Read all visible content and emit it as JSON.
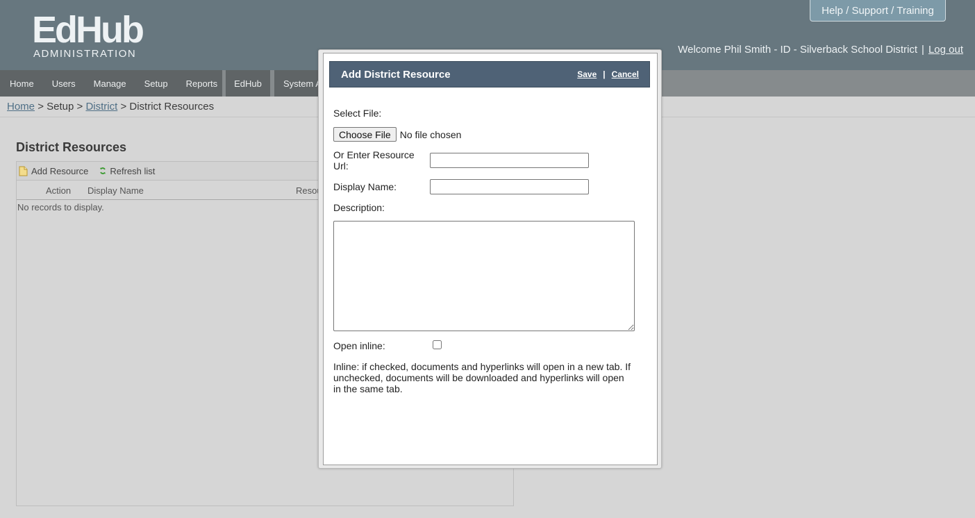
{
  "app": {
    "logo_main": "EdHub",
    "logo_sub": "ADMINISTRATION",
    "help_button": "Help / Support / Training",
    "welcome_text": "Welcome Phil Smith - ID - Silverback School District",
    "welcome_separator": "|",
    "logout": "Log out"
  },
  "nav": {
    "items": [
      "Home",
      "Users",
      "Manage",
      "Setup",
      "Reports",
      "EdHub",
      "System A"
    ]
  },
  "breadcrumb": {
    "home": "Home",
    "sep1": ">",
    "setup": "Setup",
    "sep2": ">",
    "district": "District",
    "sep3": ">",
    "current": "District Resources"
  },
  "page": {
    "title": "District Resources",
    "toolbar": {
      "add_resource": "Add Resource",
      "refresh_list": "Refresh list"
    },
    "columns": [
      "Action",
      "Display Name",
      "Resou"
    ],
    "empty_message": "No records to display."
  },
  "modal": {
    "title": "Add District Resource",
    "save": "Save",
    "separator": "|",
    "cancel": "Cancel",
    "select_file_label": "Select File:",
    "choose_file_button": "Choose File",
    "no_file_text": "No file chosen",
    "resource_url_label_line1": "Or Enter Resource",
    "resource_url_label_line2": "Url:",
    "resource_url_value": "",
    "display_name_label": "Display Name:",
    "display_name_value": "",
    "description_label": "Description:",
    "description_value": "",
    "open_inline_label": "Open inline:",
    "open_inline_checked": false,
    "help_text": "Inline: if checked, documents and hyperlinks will open in a new tab. If unchecked, documents will be downloaded and hyperlinks will open in the same tab."
  },
  "colors": {
    "header_bg": "#67777f",
    "nav_bg": "#5f6466",
    "modal_title_bg": "#4f6276",
    "link": "#4f6f86"
  }
}
